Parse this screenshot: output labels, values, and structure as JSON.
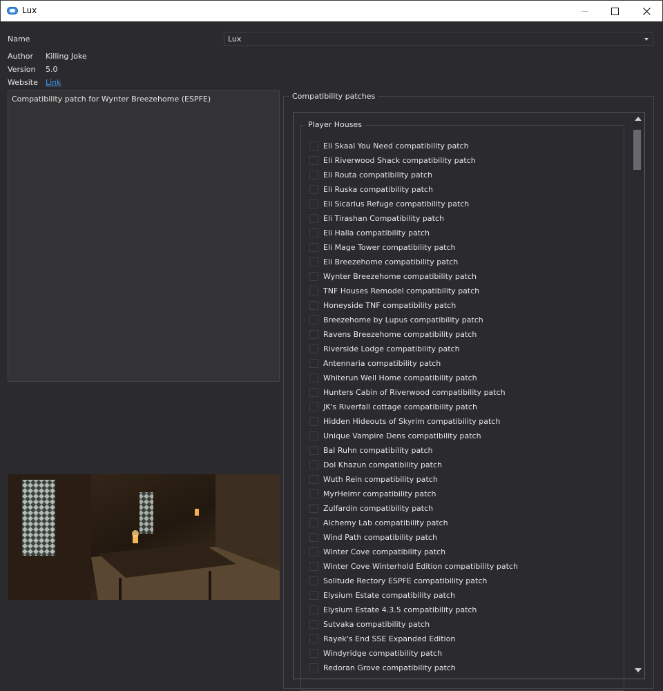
{
  "window": {
    "title": "Lux",
    "icon": "app-cloud-icon"
  },
  "info": {
    "name_label": "Name",
    "name_value": "Lux",
    "author_label": "Author",
    "author_value": "Killing Joke",
    "version_label": "Version",
    "version_value": "5.0",
    "website_label": "Website",
    "website_value": "Link"
  },
  "description": "Compatibility patch for Wynter Breezehome (ESPFE)",
  "patches": {
    "group_title": "Compatibility patches",
    "subgroup_title": "Player Houses",
    "items": [
      "Eli Skaal You Need compatibility patch",
      "Eli Riverwood Shack compatibility patch",
      "Eli Routa compatibility patch",
      "Eli Ruska compatibility patch",
      "Eli Sicarius Refuge compatibility patch",
      "Eli Tirashan Compatibility patch",
      "Eli Halla compatibility patch",
      "Eli Mage Tower compatibility patch",
      "Eli Breezehome compatibility patch",
      "Wynter Breezehome compatibility patch",
      "TNF Houses Remodel compatibility patch",
      "Honeyside TNF compatibility patch",
      "Breezehome by Lupus compatibility patch",
      "Ravens Breezehome compatibility patch",
      "Riverside Lodge compatibility patch",
      "Antennaria compatibility patch",
      "Whiterun Well Home compatibility patch",
      "Hunters Cabin of Riverwood compatibility patch",
      "JK's Riverfall cottage compatibility patch",
      "Hidden Hideouts of Skyrim compatibility patch",
      "Unique Vampire Dens compatibility patch",
      "Bal Ruhn compatibility patch",
      "Dol Khazun compatibility patch",
      "Wuth Rein compatibility patch",
      "MyrHeimr compatibility patch",
      "Zulfardin compatibility patch",
      "Alchemy Lab compatibility patch",
      "Wind Path compatibility patch",
      "Winter Cove compatibility patch",
      "Winter Cove Winterhold Edition compatibility patch",
      "Solitude Rectory ESPFE compatibility patch",
      "Elysium Estate compatibility patch",
      "Elysium Estate 4.3.5 compatibility patch",
      "Sutvaka compatibility patch",
      "Rayek's End SSE Expanded Edition",
      "Windyridge compatibility patch",
      "Redoran Grove compatibility patch"
    ]
  }
}
